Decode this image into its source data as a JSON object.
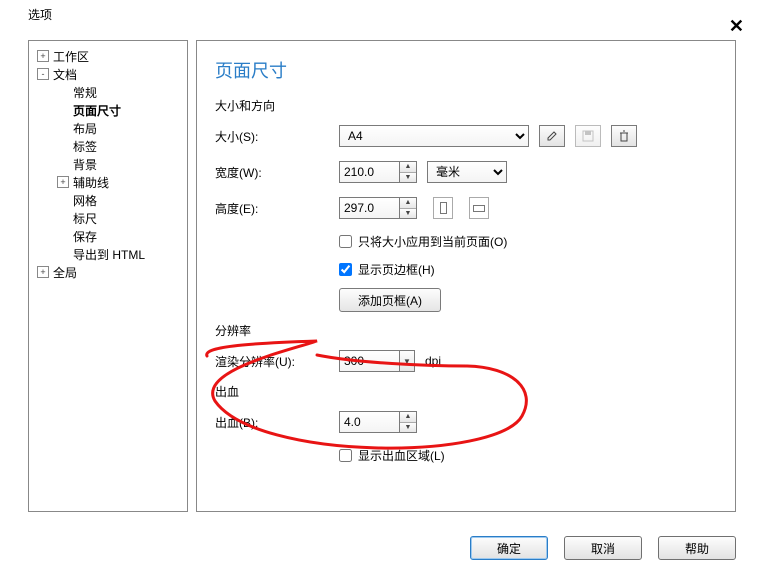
{
  "window": {
    "title": "选项"
  },
  "tree": {
    "items": [
      {
        "label": "工作区",
        "indent": 0,
        "toggle": "+"
      },
      {
        "label": "文档",
        "indent": 0,
        "toggle": "-"
      },
      {
        "label": "常规",
        "indent": 1,
        "toggle": ""
      },
      {
        "label": "页面尺寸",
        "indent": 1,
        "toggle": "",
        "selected": true
      },
      {
        "label": "布局",
        "indent": 1,
        "toggle": ""
      },
      {
        "label": "标签",
        "indent": 1,
        "toggle": ""
      },
      {
        "label": "背景",
        "indent": 1,
        "toggle": ""
      },
      {
        "label": "辅助线",
        "indent": 1,
        "toggle": "+"
      },
      {
        "label": "网格",
        "indent": 1,
        "toggle": ""
      },
      {
        "label": "标尺",
        "indent": 1,
        "toggle": ""
      },
      {
        "label": "保存",
        "indent": 1,
        "toggle": ""
      },
      {
        "label": "导出到 HTML",
        "indent": 1,
        "toggle": ""
      },
      {
        "label": "全局",
        "indent": 0,
        "toggle": "+"
      }
    ]
  },
  "page": {
    "heading": "页面尺寸",
    "size_section": "大小和方向",
    "size_label": "大小(S):",
    "size_value": "A4",
    "width_label": "宽度(W):",
    "width_value": "210.0",
    "unit_value": "毫米",
    "height_label": "高度(E):",
    "height_value": "297.0",
    "apply_current_label": "只将大小应用到当前页面(O)",
    "apply_current_checked": false,
    "show_border_label": "显示页边框(H)",
    "show_border_checked": true,
    "add_frame_label": "添加页框(A)",
    "resolution_section": "分辨率",
    "render_res_label": "渲染分辨率(U):",
    "render_res_value": "300",
    "render_res_unit": "dpi",
    "bleed_section": "出血",
    "bleed_label": "出血(B):",
    "bleed_value": "4.0",
    "show_bleed_area_label": "显示出血区域(L)",
    "show_bleed_area_checked": false
  },
  "footer": {
    "ok": "确定",
    "cancel": "取消",
    "help": "帮助"
  }
}
